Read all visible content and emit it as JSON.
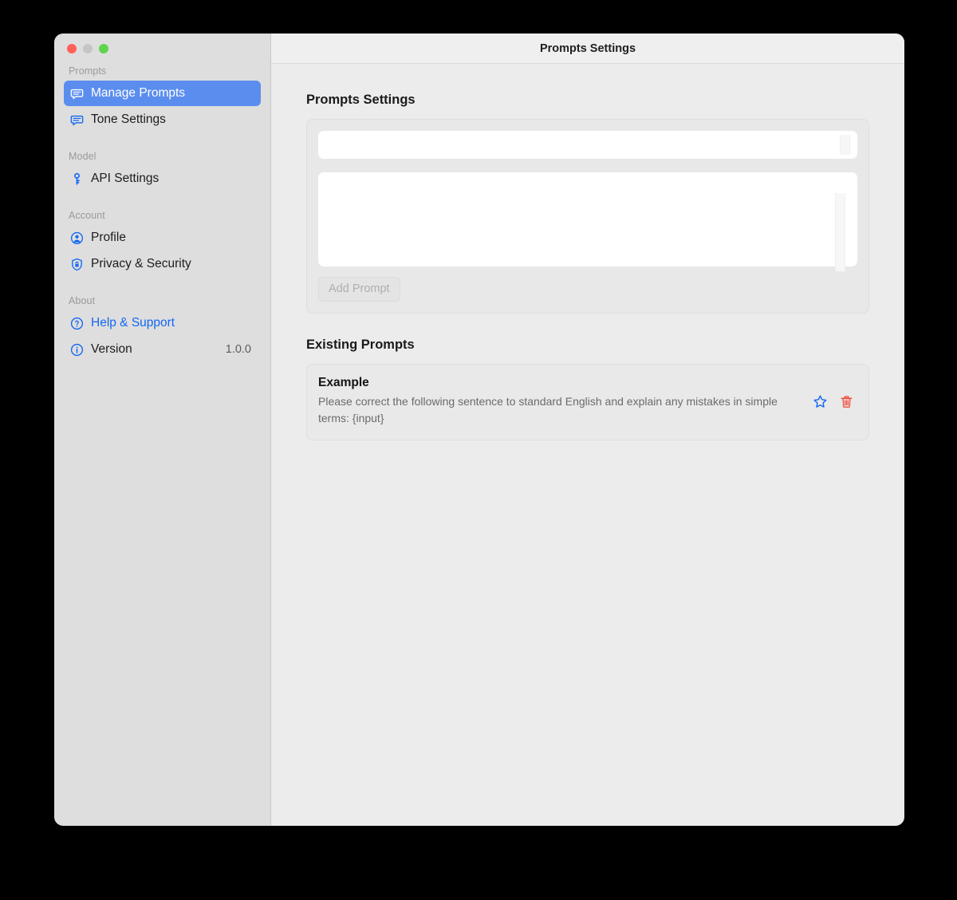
{
  "window": {
    "title": "Prompts Settings",
    "traffic_lights": [
      {
        "name": "close",
        "color": "#FF6159"
      },
      {
        "name": "minimize",
        "color": "#C6C5C5"
      },
      {
        "name": "zoom",
        "color": "#5FD44D"
      }
    ]
  },
  "sidebar": {
    "groups": [
      {
        "label": "Prompts",
        "items": [
          {
            "label": "Manage Prompts",
            "icon": "speech-bubble-icon",
            "selected": true,
            "style": "normal",
            "value": ""
          },
          {
            "label": "Tone Settings",
            "icon": "speech-bubble-icon",
            "selected": false,
            "style": "normal",
            "value": ""
          }
        ]
      },
      {
        "label": "Model",
        "items": [
          {
            "label": "API Settings",
            "icon": "key-icon",
            "selected": false,
            "style": "normal",
            "value": ""
          }
        ]
      },
      {
        "label": "Account",
        "items": [
          {
            "label": "Profile",
            "icon": "person-circle-icon",
            "selected": false,
            "style": "normal",
            "value": ""
          },
          {
            "label": "Privacy & Security",
            "icon": "shield-lock-icon",
            "selected": false,
            "style": "normal",
            "value": ""
          }
        ]
      },
      {
        "label": "About",
        "items": [
          {
            "label": "Help & Support",
            "icon": "question-circle-icon",
            "selected": false,
            "style": "link",
            "value": ""
          },
          {
            "label": "Version",
            "icon": "info-circle-icon",
            "selected": false,
            "style": "normal",
            "value": "1.0.0"
          }
        ]
      }
    ]
  },
  "main": {
    "settings_heading": "Prompts Settings",
    "name_field": {
      "value": "",
      "placeholder": ""
    },
    "content_field": {
      "value": "",
      "placeholder": ""
    },
    "add_button": {
      "label": "Add Prompt",
      "enabled": false
    },
    "existing_heading": "Existing Prompts",
    "prompts": [
      {
        "title": "Example",
        "text": "Please correct the following sentence to standard English and explain any mistakes in simple terms: {input}",
        "favorite_icon": "star-icon",
        "delete_icon": "trash-icon"
      }
    ]
  },
  "colors": {
    "accent_selected": "#5B8DEF",
    "link": "#1268F3",
    "icon_blue": "#1268F3",
    "danger": "#F0503C",
    "sidebar_bg": "#DFDEDE",
    "main_bg": "#ECECEC"
  }
}
